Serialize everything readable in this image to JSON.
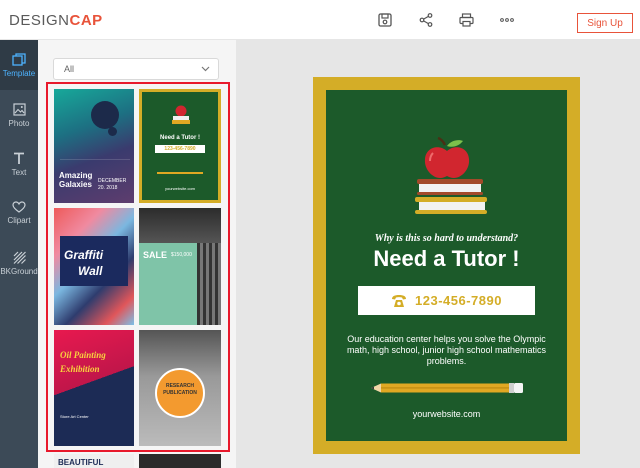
{
  "header": {
    "logo_design": "DESIGN",
    "logo_cap": "CAP",
    "signup_label": "Sign Up"
  },
  "rail": {
    "items": [
      {
        "label": "Template",
        "icon": "template-icon",
        "active": true
      },
      {
        "label": "Photo",
        "icon": "photo-icon",
        "active": false
      },
      {
        "label": "Text",
        "icon": "text-icon",
        "active": false
      },
      {
        "label": "Clipart",
        "icon": "heart-icon",
        "active": false
      },
      {
        "label": "BKGround",
        "icon": "background-icon",
        "active": false
      }
    ]
  },
  "panel": {
    "filter_value": "All",
    "templates": [
      {
        "title1": "Amazing",
        "title2": "Galaxies",
        "date": "DECEMBER",
        "year": "20. 2018"
      },
      {
        "title": "Need a Tutor !",
        "phone": "123-456-7890",
        "site": "yourwebsite.com"
      },
      {
        "title1": "Graffiti",
        "title2": "Wall"
      },
      {
        "title": "SALE",
        "price": "$150,000"
      },
      {
        "title1": "Oil Painting",
        "title2": "Exhibition",
        "venue": "Store Art Center"
      },
      {
        "title1": "RESEARCH",
        "title2": "PUBLICATION"
      },
      {
        "title": "BEAUTIFUL"
      }
    ]
  },
  "poster": {
    "subtitle": "Why is this so hard to understand?",
    "title": "Need a Tutor !",
    "phone": "123-456-7890",
    "body": "Our education center helps you solve the Olympic math, high school, junior high school mathematics problems.",
    "website": "yourwebsite.com",
    "colors": {
      "frame": "#d4ad27",
      "board": "#1c5a2a",
      "accent": "#e8533a"
    }
  }
}
